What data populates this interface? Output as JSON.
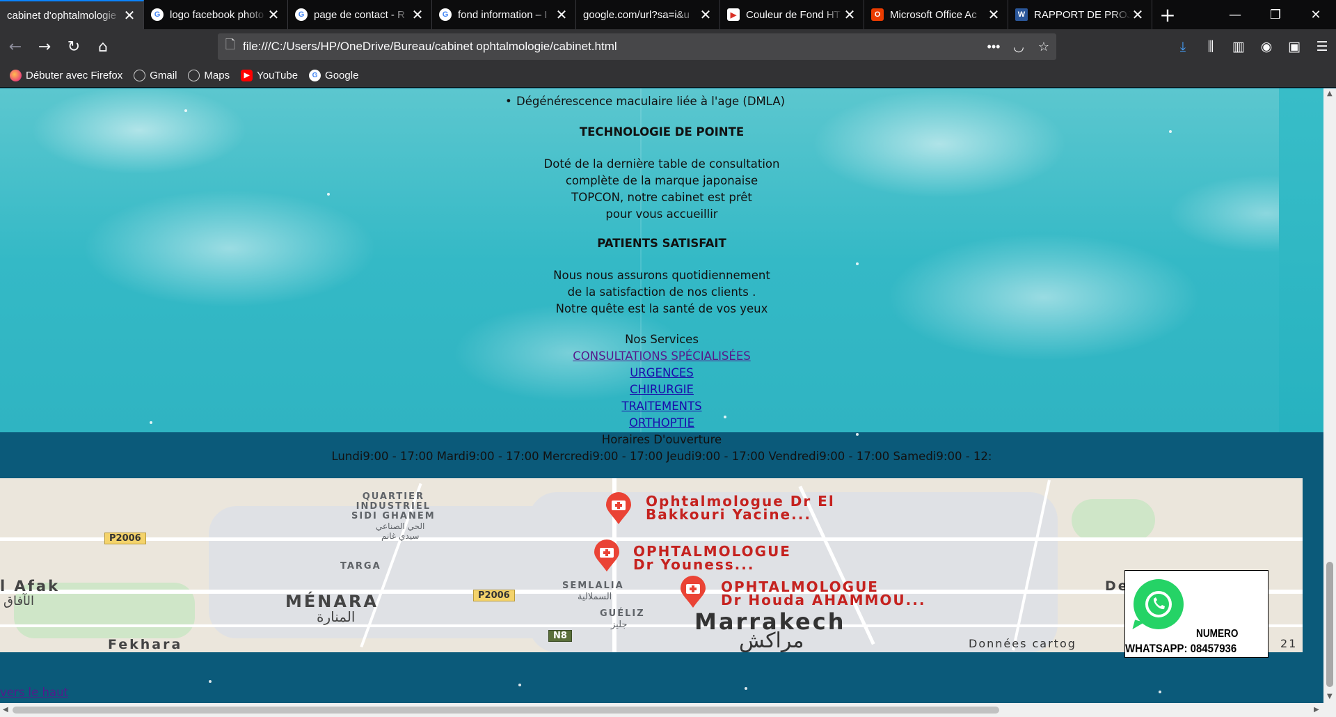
{
  "browser": {
    "tabs": [
      {
        "label": "cabinet d'ophtalmologie",
        "favicon": "page-icon",
        "active": true
      },
      {
        "label": "logo facebook photo",
        "favicon": "google-icon",
        "active": false
      },
      {
        "label": "page de contact - R",
        "favicon": "google-icon",
        "active": false
      },
      {
        "label": "fond information – I",
        "favicon": "google-icon",
        "active": false
      },
      {
        "label": "google.com/url?sa=i&u",
        "favicon": "none",
        "active": false
      },
      {
        "label": "Couleur de Fond HT",
        "favicon": "youtube-red-icon",
        "active": false
      },
      {
        "label": "Microsoft Office Ac",
        "favicon": "office-icon",
        "active": false
      },
      {
        "label": "RAPPORT DE PROJE",
        "favicon": "word-icon",
        "active": false
      }
    ],
    "new_tab": "+",
    "url": "file:///C:/Users/HP/OneDrive/Bureau/cabinet ophtalmologie/cabinet.html",
    "bookmarks": [
      {
        "label": "Débuter avec Firefox",
        "icon": "firefox-icon"
      },
      {
        "label": "Gmail",
        "icon": "globe-icon"
      },
      {
        "label": "Maps",
        "icon": "globe-icon"
      },
      {
        "label": "YouTube",
        "icon": "youtube-icon"
      },
      {
        "label": "Google",
        "icon": "google-icon"
      }
    ]
  },
  "page": {
    "bullet_item": "Dégénérescence maculaire liée à l'age (DMLA)",
    "tech_heading": "TECHNOLOGIE DE POINTE",
    "tech_lines": [
      "Doté de la dernière table de consultation",
      "complète de la marque japonaise",
      "TOPCON, notre cabinet est prêt",
      "pour vous accueillir"
    ],
    "patients_heading": "PATIENTS SATISFAIT",
    "patients_lines": [
      "Nous nous assurons quotidiennement",
      "de la satisfaction de nos clients .",
      "Notre quête est la santé de vos yeux"
    ],
    "services_title": "Nos Services",
    "services": [
      {
        "label": "CONSULTATIONS SPÉCIALISÉES",
        "visited": true
      },
      {
        "label": "URGENCES",
        "visited": false
      },
      {
        "label": "CHIRURGIE",
        "visited": false
      },
      {
        "label": "TRAITEMENTS",
        "visited": false
      },
      {
        "label": "ORTHOPTIE",
        "visited": false
      }
    ],
    "hours_title": "Horaires D'ouverture",
    "hours_line": "Lundi9:00 - 17:00 Mardi9:00 - 17:00 Mercredi9:00 - 17:00 Jeudi9:00 - 17:00 Vendredi9:00 - 17:00 Samedi9:00 - 12:",
    "back_to_top": "vers le haut"
  },
  "map": {
    "districts": {
      "quartier": "QUARTIER\nINDUSTRIEL\nSIDI GHANEM",
      "quartier_ar": "الحي الصناعي\nسيدي غانم",
      "targa": "TARGA",
      "afak": "l Afak",
      "afak_ar": "الآفاق",
      "menara": "MÉNARA",
      "menara_ar": "المنارة",
      "fekhara": "Fekhara",
      "semlalia": "SEMLALIA",
      "semlalia_ar": "السملالية",
      "gueliz": "GUÉLIZ",
      "gueliz_ar": "جليز",
      "marrakech": "Marrakech",
      "marrakech_ar": "مراكش",
      "de": "De"
    },
    "roads": [
      "P2006",
      "P2006",
      "N8"
    ],
    "places": [
      {
        "line1": "Ophtalmologue Dr El",
        "line2": "Bakkouri Yacine..."
      },
      {
        "line1": "OPHTALMOLOGUE",
        "line2": "Dr Youness..."
      },
      {
        "line1": "OPHTALMOLOGUE",
        "line2": "Dr Houda AHAMMOU..."
      }
    ],
    "credit": "Données cartog",
    "credit_year": "21"
  },
  "whatsapp": {
    "label": "NUMERO",
    "number_line": "WHATSAPP: 08457936"
  },
  "colors": {
    "sky": "#34b9c6",
    "band": "#0b5a7a",
    "link": "#1a0dab",
    "visited": "#551a8b",
    "whatsapp_green": "#25d366"
  }
}
